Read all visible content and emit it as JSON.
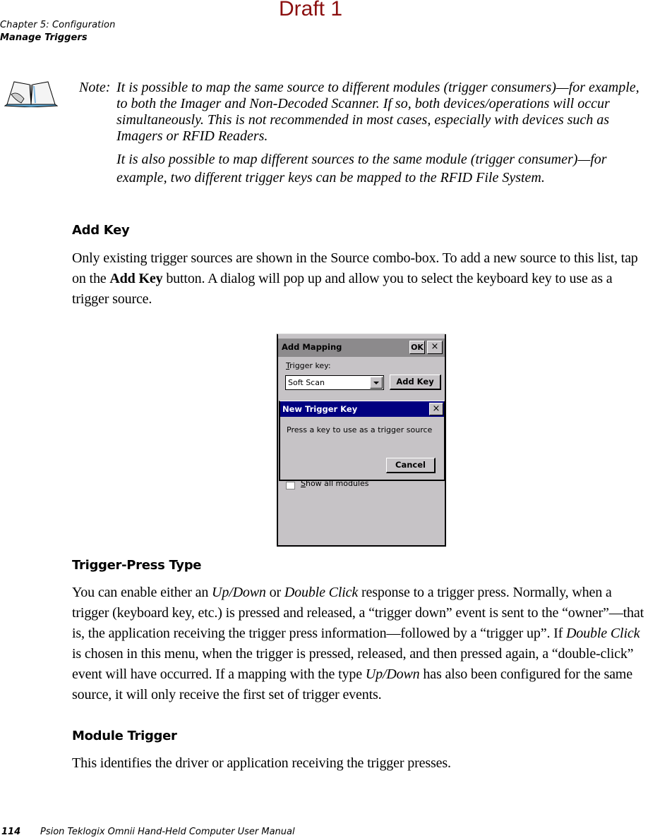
{
  "watermark": "Draft 1",
  "running_head": {
    "chapter": "Chapter 5:  Configuration",
    "section": "Manage Triggers"
  },
  "note": {
    "icon": "open-book-icon",
    "label": "Note:",
    "paragraph1": "It is possible to map the same source to different modules (trigger consumers)—for example, to both the Imager and Non-Decoded Scanner. If so, both devices/operations will occur simultaneously. This is not recommended in most cases, especially with devices such as Imagers or RFID Readers.",
    "paragraph2": "It is also possible to map different sources to the same module (trigger consumer)—for example, two different trigger keys can be mapped to the RFID File System."
  },
  "sections": {
    "add_key": {
      "heading": "Add Key",
      "text_before": "Only existing trigger sources are shown in the Source combo-box. To add a new source to this list, tap on the ",
      "bold": "Add Key",
      "text_after": " button. A dialog will pop up and allow you to select the keyboard key to use as a trigger source."
    },
    "trigger_press_type": {
      "heading": "Trigger-Press Type",
      "t1": "You can enable either an ",
      "i1": "Up/Down",
      "t2": " or ",
      "i2": "Double Click",
      "t3": " response to a trigger press. Normally, when a trigger (keyboard key, etc.) is pressed and released, a “trigger down” event is sent to the “owner”—that is, the application receiving the trigger press information—followed by a “trigger up”. If ",
      "i3": "Double Click",
      "t4": " is chosen in this menu, when the trigger is pressed, released, and then pressed again, a “double-click” event will have occurred. If a mapping with the type ",
      "i4": "Up/Down",
      "t5": " has also been configured for the same source, it will only receive the first set of trigger events."
    },
    "module_trigger": {
      "heading": "Module Trigger",
      "text": "This identifies the driver or application receiving the trigger presses."
    }
  },
  "screenshot": {
    "add_mapping_dialog": {
      "title": "Add Mapping",
      "ok_label": "OK",
      "close_label": "×",
      "trigger_key_label_underlined": "T",
      "trigger_key_label_rest": "rigger key:",
      "trigger_key_value": "Soft Scan",
      "add_key_label": "Add Key",
      "show_all_modules_underlined": "S",
      "show_all_modules_rest": "how all modules",
      "show_all_modules_checked": false
    },
    "new_trigger_key_dialog": {
      "title": "New Trigger Key",
      "close_label": "×",
      "message": "Press a key to use as a trigger source",
      "cancel_label": "Cancel"
    },
    "colors": {
      "dialog_bg": "#c6c3c6",
      "inactive_title": "#8c8a8c",
      "active_title": "#000080"
    }
  },
  "footer": {
    "page_number": "114",
    "title": "Psion Teklogix Omnii Hand-Held Computer User Manual"
  }
}
